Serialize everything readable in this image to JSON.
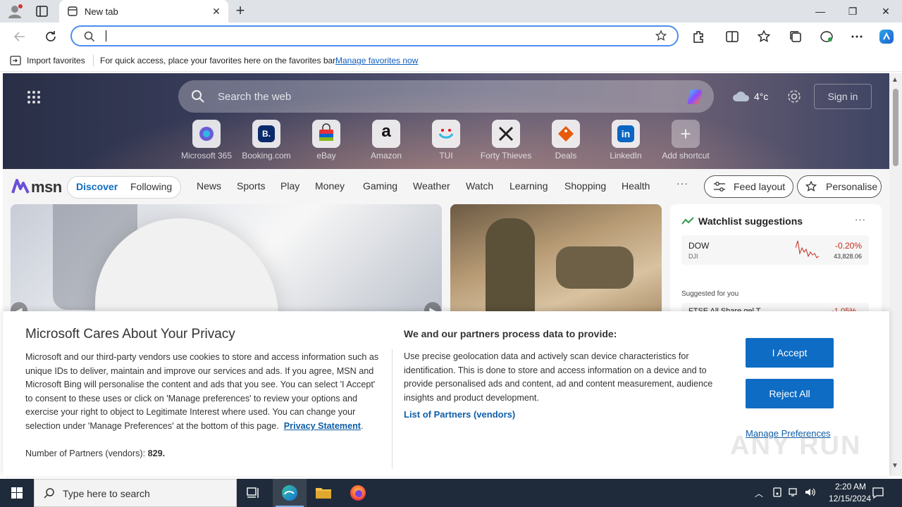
{
  "browser": {
    "tab_title": "New tab",
    "favorites_bar": {
      "import_label": "Import favorites",
      "hint": "For quick access, place your favorites here on the favorites bar.",
      "manage_link": "Manage favorites now"
    }
  },
  "msn": {
    "search_placeholder": "Search the web",
    "weather_temp": "4°c",
    "sign_in": "Sign in",
    "shortcuts": [
      {
        "label": "Microsoft 365",
        "icon": "microsoft-365-icon"
      },
      {
        "label": "Booking.com",
        "icon": "booking-icon",
        "glyph": "B."
      },
      {
        "label": "eBay",
        "icon": "ebay-icon"
      },
      {
        "label": "Amazon",
        "icon": "amazon-icon",
        "glyph": "a"
      },
      {
        "label": "TUI",
        "icon": "tui-icon"
      },
      {
        "label": "Forty Thieves",
        "icon": "forty-thieves-icon"
      },
      {
        "label": "Deals",
        "icon": "deals-icon"
      },
      {
        "label": "LinkedIn",
        "icon": "linkedin-icon",
        "glyph": "in"
      },
      {
        "label": "Add shortcut",
        "icon": "plus-icon",
        "glyph": "+"
      }
    ],
    "logo_text": "msn",
    "feed_tabs": {
      "discover": "Discover",
      "following": "Following"
    },
    "nav": [
      "News",
      "Sports",
      "Play",
      "Money",
      "Gaming",
      "Weather",
      "Watch",
      "Learning",
      "Shopping",
      "Health"
    ],
    "nav_more": "···",
    "feed_layout": "Feed layout",
    "personalise": "Personalise",
    "watchlist": {
      "title": "Watchlist suggestions",
      "more": "···",
      "symbol": "DOW",
      "exchange": "DJI",
      "change": "-0.20%",
      "value": "43,828.06",
      "suggested_label": "Suggested for you",
      "symbol2": "FTSE All Share gel T",
      "change2": "-1.05%"
    }
  },
  "privacy": {
    "title": "Microsoft Cares About Your Privacy",
    "body": "Microsoft and our third-party vendors use cookies to store and access information such as unique IDs to deliver, maintain and improve our services and ads. If you agree, MSN and Microsoft Bing will personalise the content and ads that you see. You can select 'I Accept' to consent to these uses or click on 'Manage preferences' to review your options and exercise your right to object to Legitimate Interest where used.  You can change your selection under 'Manage Preferences' at the bottom of this page.",
    "statement_link": "Privacy Statement",
    "partners_label": "Number of Partners (vendors):",
    "partners_count": "829.",
    "purposes_title": "We and our partners process data to provide:",
    "purposes_body": "Use precise geolocation data and actively scan device characteristics for identification. This is done to store and access information on a device and to provide personalised ads and content, ad and content measurement, audience insights and product development.",
    "partners_link": "List of Partners (vendors)",
    "accept": "I Accept",
    "reject": "Reject All",
    "manage": "Manage Preferences"
  },
  "watermark": "ANY RUN",
  "taskbar": {
    "search_placeholder": "Type here to search",
    "time": "2:20 AM",
    "date": "12/15/2024"
  },
  "colors": {
    "accent": "#0e6cc4",
    "link": "#0e5ea8",
    "taskbar": "#1f2b3a",
    "negative": "#c42b1c"
  }
}
